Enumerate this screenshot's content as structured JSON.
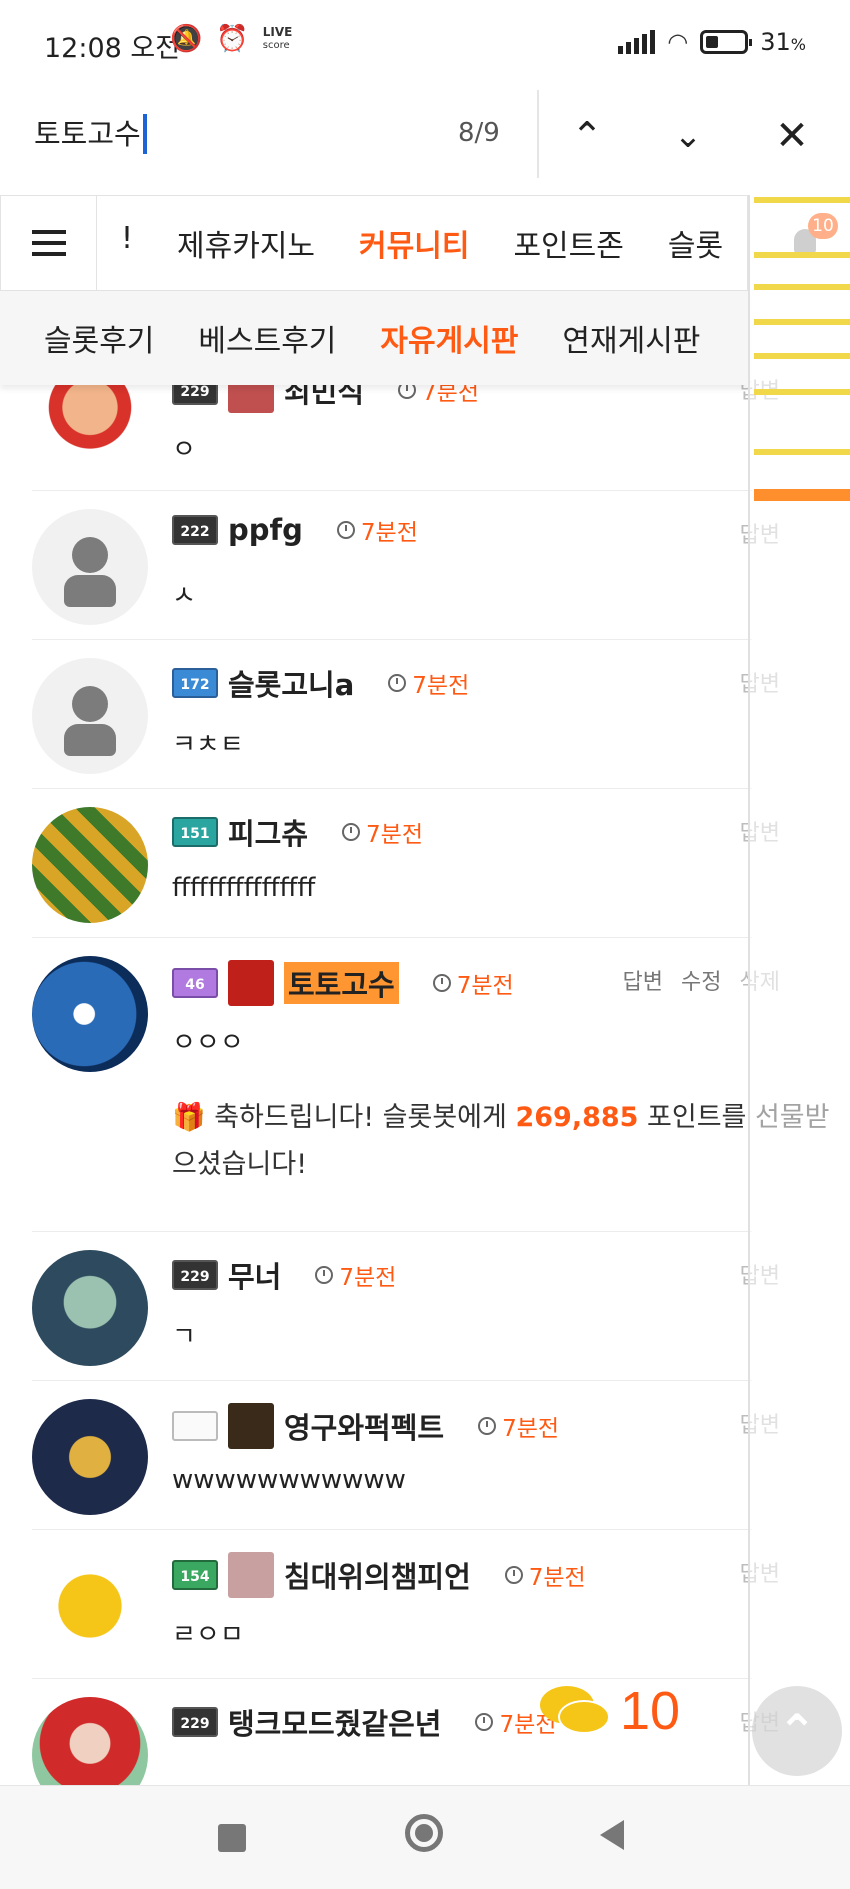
{
  "status_bar": {
    "time": "12:08 오전",
    "live_line1": "LIVE",
    "live_line2": "score",
    "battery": "31",
    "battery_unit": "%"
  },
  "find_bar": {
    "query": "토토고수",
    "count": "8/9"
  },
  "nav_main": {
    "items": [
      "!",
      "제휴카지노",
      "커뮤니티",
      "포인트존",
      "슬롯"
    ],
    "active": "커뮤니티"
  },
  "nav_sub": {
    "items": [
      "슬롯후기",
      "베스트후기",
      "자유게시판",
      "연재게시판"
    ],
    "active": "자유게시판"
  },
  "comments": [
    {
      "level": "229",
      "nick": "쇠민식",
      "time": "7분전",
      "text": "ㅇ",
      "actions": [
        "답변"
      ]
    },
    {
      "level": "222",
      "nick": "ppfg",
      "time": "7분전",
      "text": "ㅅ",
      "actions": [
        "답변"
      ]
    },
    {
      "level": "172",
      "nick": "슬롯고니a",
      "time": "7분전",
      "text": "ㅋㅊㅌ",
      "actions": [
        "답변"
      ]
    },
    {
      "level": "151",
      "nick": "피그츄",
      "time": "7분전",
      "text": "ffffffffffffffff",
      "actions": [
        "답변"
      ]
    },
    {
      "level": "46",
      "nick": "토토고수",
      "time": "7분전",
      "text": "ㅇㅇㅇ",
      "actions": [
        "답변",
        "수정",
        "삭제"
      ],
      "notice_pre": "축하드립니다! 슬롯봇에게 ",
      "notice_points": "269,885",
      "notice_post": " 포인트를 선물받으셨습니다!"
    },
    {
      "level": "229",
      "nick": "무너",
      "time": "7분전",
      "text": "ㄱ",
      "actions": [
        "답변"
      ]
    },
    {
      "level": "",
      "nick": "영구와퍽펙트",
      "time": "7분전",
      "text": "wwwwwwwwwww",
      "actions": [
        "답변"
      ]
    },
    {
      "level": "154",
      "nick": "침대위의챔피언",
      "time": "7분전",
      "text": "ㄹㅇㅁ",
      "actions": [
        "답변"
      ]
    },
    {
      "level": "229",
      "nick": "탱크모드줬같은년",
      "time": "7분전",
      "text": "",
      "actions": [
        "답변"
      ]
    }
  ],
  "notifications": {
    "badge": "10"
  },
  "chat_fab": {
    "count": "10"
  },
  "colors": {
    "accent": "#ff5a13",
    "find_match": "#f0d84a",
    "find_current": "#ff8f2c"
  },
  "icons": [
    "mute-bell-icon",
    "alarm-icon",
    "signal-icon",
    "wifi-icon",
    "battery-icon",
    "chevron-up-icon",
    "chevron-down-icon",
    "close-icon",
    "hamburger-icon",
    "bell-icon",
    "clock-icon",
    "gift-icon",
    "chat-icon",
    "arrow-up-icon"
  ]
}
